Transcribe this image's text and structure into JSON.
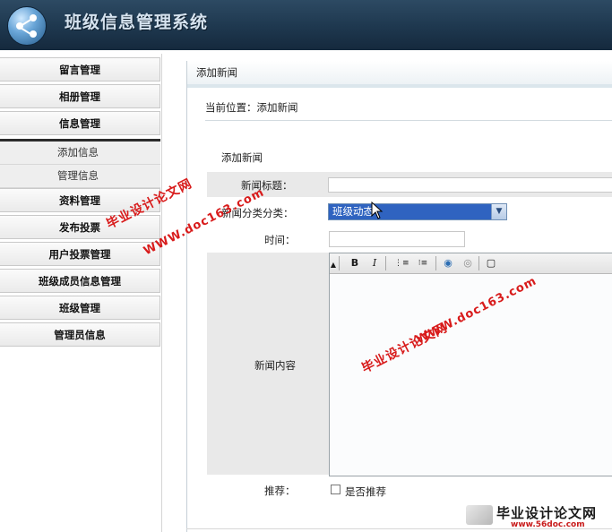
{
  "header": {
    "title": "班级信息管理系统"
  },
  "sidebar": {
    "items": [
      {
        "label": "留言管理"
      },
      {
        "label": "相册管理"
      },
      {
        "label": "信息管理"
      },
      {
        "label": "资料管理"
      },
      {
        "label": "发布投票"
      },
      {
        "label": "用户投票管理"
      },
      {
        "label": "班级成员信息管理"
      },
      {
        "label": "班级管理"
      },
      {
        "label": "管理员信息"
      }
    ],
    "submenu": [
      {
        "label": "添加信息"
      },
      {
        "label": "管理信息"
      }
    ]
  },
  "main": {
    "panel_title": "添加新闻",
    "breadcrumb": "当前位置：添加新闻",
    "section_title": "添加新闻",
    "form": {
      "title_label": "新闻标题：",
      "title_value": "",
      "category_label": "新闻分类分类：",
      "category_value": "班级动态",
      "time_label": "时间：",
      "time_value": "",
      "content_label": "新闻内容",
      "recommend_label": "推荐：",
      "recommend_option": "是否推荐"
    },
    "editor_toolbar": [
      {
        "icon": "bold-icon",
        "glyph": "B"
      },
      {
        "icon": "italic-icon",
        "glyph": "I"
      },
      {
        "icon": "ordered-list-icon",
        "glyph": "⋮≡"
      },
      {
        "icon": "unordered-list-icon",
        "glyph": "⁝≡"
      },
      {
        "icon": "link-icon",
        "glyph": "◉"
      },
      {
        "icon": "unlink-icon",
        "glyph": "◎"
      },
      {
        "icon": "source-icon",
        "glyph": "▢"
      }
    ]
  },
  "watermarks": {
    "text_cn": "毕业设计论文网",
    "text_url": "WWW.doc163.com",
    "footer_cn": "毕业设计论文网",
    "footer_url": "www.56doc.com"
  }
}
